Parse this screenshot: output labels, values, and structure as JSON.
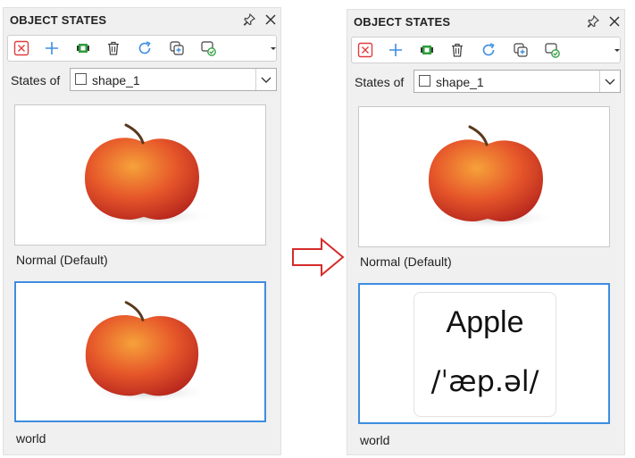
{
  "panels": [
    {
      "title": "OBJECT STATES",
      "states_label": "States of",
      "dropdown_value": "shape_1",
      "states": [
        {
          "label": "Normal (Default)",
          "content": "apple-photo",
          "selected": false
        },
        {
          "label": "world",
          "content": "apple-photo",
          "selected": true
        }
      ]
    },
    {
      "title": "OBJECT STATES",
      "states_label": "States of",
      "dropdown_value": "shape_1",
      "states": [
        {
          "label": "Normal (Default)",
          "content": "apple-photo",
          "selected": false
        },
        {
          "label": "world",
          "content": "word-card",
          "selected": true,
          "card": {
            "word": "Apple",
            "pronunciation": "/ˈæp.əl/"
          }
        }
      ]
    }
  ],
  "icons": {
    "pin": "pin-icon",
    "close": "close-icon",
    "toolbar": [
      "delete-state-icon",
      "add-state-icon",
      "capture-state-icon",
      "trash-icon",
      "refresh-icon",
      "duplicate-icon",
      "apply-state-icon",
      "more-dropdown-icon"
    ]
  },
  "colors": {
    "accent": "#3d8de0",
    "delete_red": "#e03c3c",
    "green": "#2e9d3c",
    "arrow_red": "#d62b2b"
  }
}
